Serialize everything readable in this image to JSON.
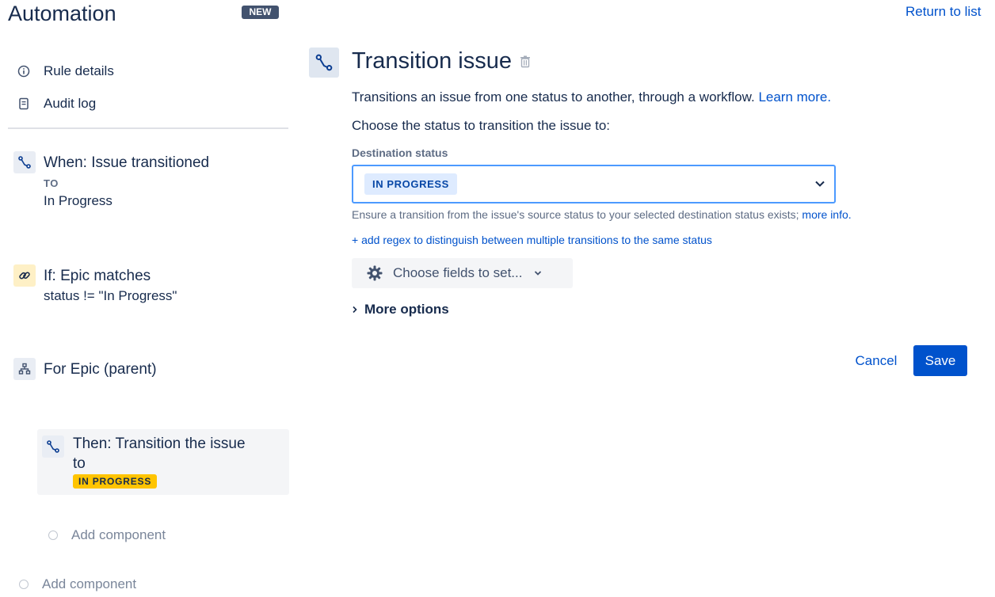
{
  "header": {
    "title": "Automation",
    "badge": "NEW",
    "return_link": "Return to list"
  },
  "sidebar": {
    "nav": [
      {
        "label": "Rule details",
        "icon": "info-icon"
      },
      {
        "label": "Audit log",
        "icon": "document-icon"
      }
    ],
    "components": {
      "trigger": {
        "title": "When: Issue transitioned",
        "to_label": "TO",
        "value": "In Progress",
        "icon": "transition-icon"
      },
      "condition": {
        "title": "If: Epic matches",
        "value": "status != \"In Progress\"",
        "icon": "link-icon"
      },
      "branch": {
        "title": "For Epic (parent)",
        "icon": "hierarchy-icon"
      },
      "action": {
        "title_line1": "Then: Transition the issue",
        "title_line2": "to",
        "status": "IN PROGRESS",
        "icon": "transition-icon"
      }
    },
    "add_component_nested": "Add component",
    "add_component": "Add component"
  },
  "main": {
    "title": "Transition issue",
    "description": "Transitions an issue from one status to another, through a workflow.",
    "learn_more": "Learn more.",
    "choose_label": "Choose the status to transition the issue to:",
    "destination_label": "Destination status",
    "destination_value": "IN PROGRESS",
    "hint_text": "Ensure a transition from the issue's source status to your selected destination status exists;",
    "hint_link": "more info.",
    "regex_link": "+ add regex to distinguish between multiple transitions to the same status",
    "fields_button": "Choose fields to set...",
    "more_options": "More options",
    "cancel": "Cancel",
    "save": "Save"
  },
  "colors": {
    "primary": "#0052cc",
    "text": "#172b4d",
    "subtle": "#5e6c84",
    "lozenge_yellow": "#ffc400",
    "lozenge_blue_bg": "#deebff",
    "focus_border": "#4c9aff"
  }
}
